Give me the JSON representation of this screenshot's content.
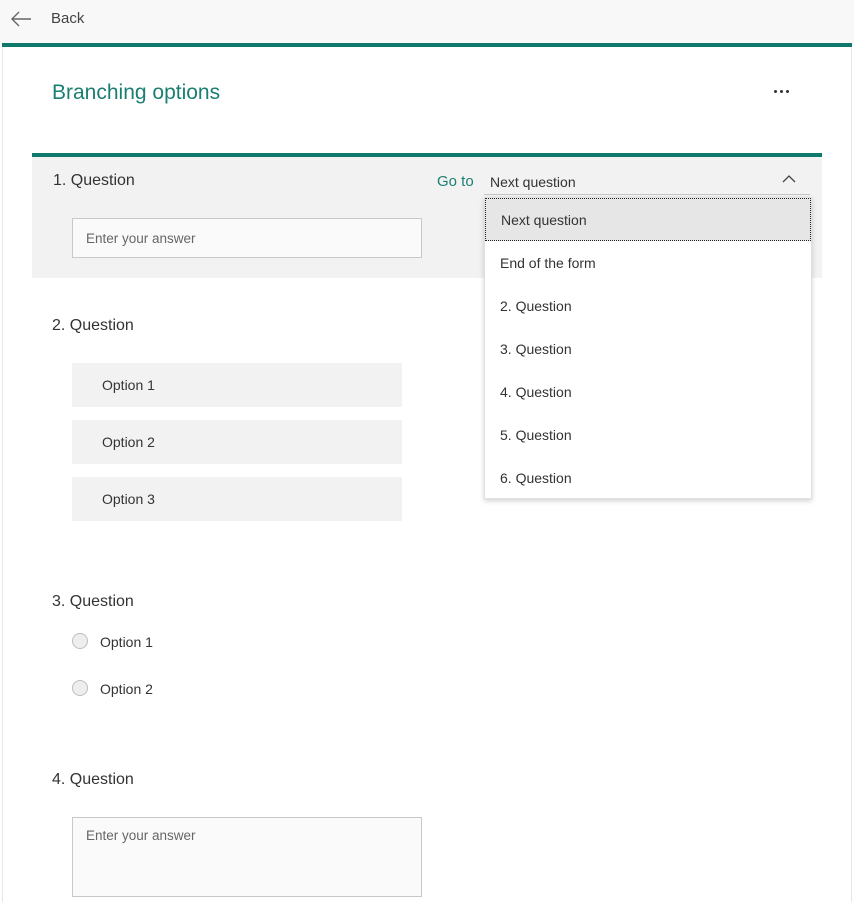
{
  "topbar": {
    "back_label": "Back"
  },
  "page": {
    "title": "Branching options",
    "more_label": "More options"
  },
  "q1": {
    "title": "1. Question",
    "goto_label": "Go to",
    "goto_value": "Next question",
    "placeholder": "Enter your answer"
  },
  "dropdown": {
    "items": [
      "Next question",
      "End of the form",
      "2. Question",
      "3. Question",
      "4. Question",
      "5. Question",
      "6. Question"
    ],
    "selected_index": 0
  },
  "q2": {
    "title": "2. Question",
    "options": [
      "Option 1",
      "Option 2",
      "Option 3"
    ]
  },
  "q3": {
    "title": "3. Question",
    "options": [
      "Option 1",
      "Option 2"
    ]
  },
  "q4": {
    "title": "4. Question",
    "placeholder": "Enter your answer"
  },
  "colors": {
    "accent": "#0f7a6c",
    "title_green": "#1a7f72"
  }
}
